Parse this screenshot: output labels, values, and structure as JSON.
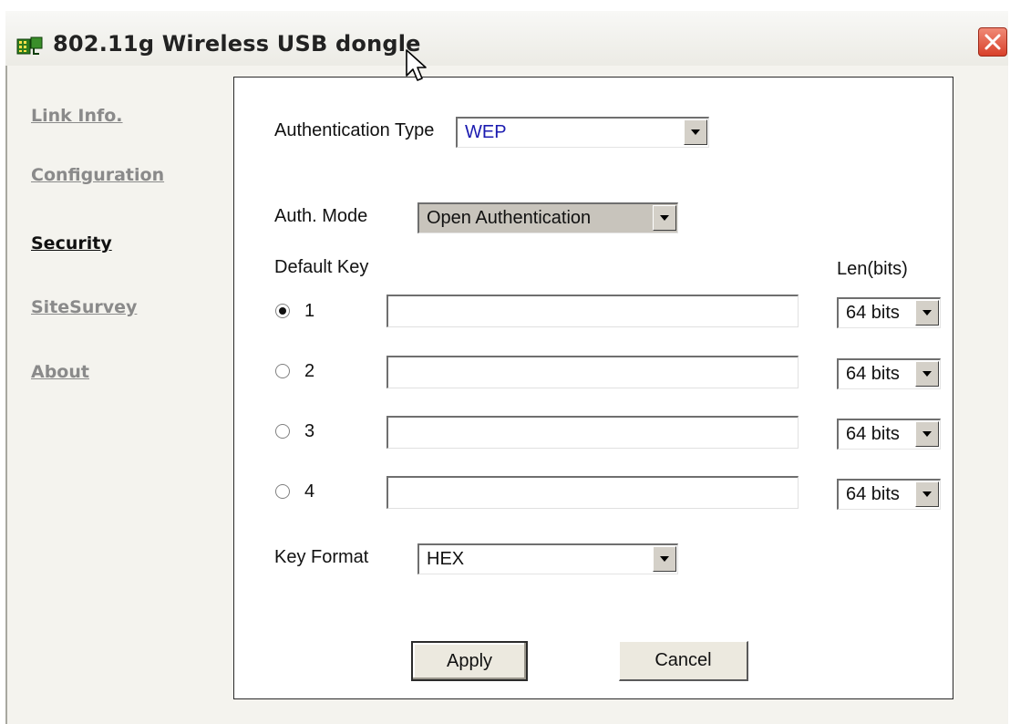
{
  "window": {
    "title": "802.11g Wireless USB dongle"
  },
  "nav": {
    "items": [
      {
        "label": "Link Info.",
        "active": false
      },
      {
        "label": "Configuration",
        "active": false
      },
      {
        "label": "Security",
        "active": true
      },
      {
        "label": "SiteSurvey",
        "active": false
      },
      {
        "label": "About",
        "active": false
      }
    ]
  },
  "security": {
    "auth_type_label": "Authentication Type",
    "auth_type_value": "WEP",
    "auth_mode_label": "Auth. Mode",
    "auth_mode_value": "Open Authentication",
    "default_key_label": "Default Key",
    "len_label": "Len(bits)",
    "keys": [
      {
        "number": "1",
        "selected": true,
        "value": "",
        "length": "64 bits"
      },
      {
        "number": "2",
        "selected": false,
        "value": "",
        "length": "64 bits"
      },
      {
        "number": "3",
        "selected": false,
        "value": "",
        "length": "64 bits"
      },
      {
        "number": "4",
        "selected": false,
        "value": "",
        "length": "64 bits"
      }
    ],
    "key_format_label": "Key Format",
    "key_format_value": "HEX"
  },
  "buttons": {
    "apply": "Apply",
    "cancel": "Cancel"
  },
  "colors": {
    "accent_blue": "#1b1bb0",
    "close_red": "#d8402a",
    "client_bg": "#f4f3ee"
  }
}
